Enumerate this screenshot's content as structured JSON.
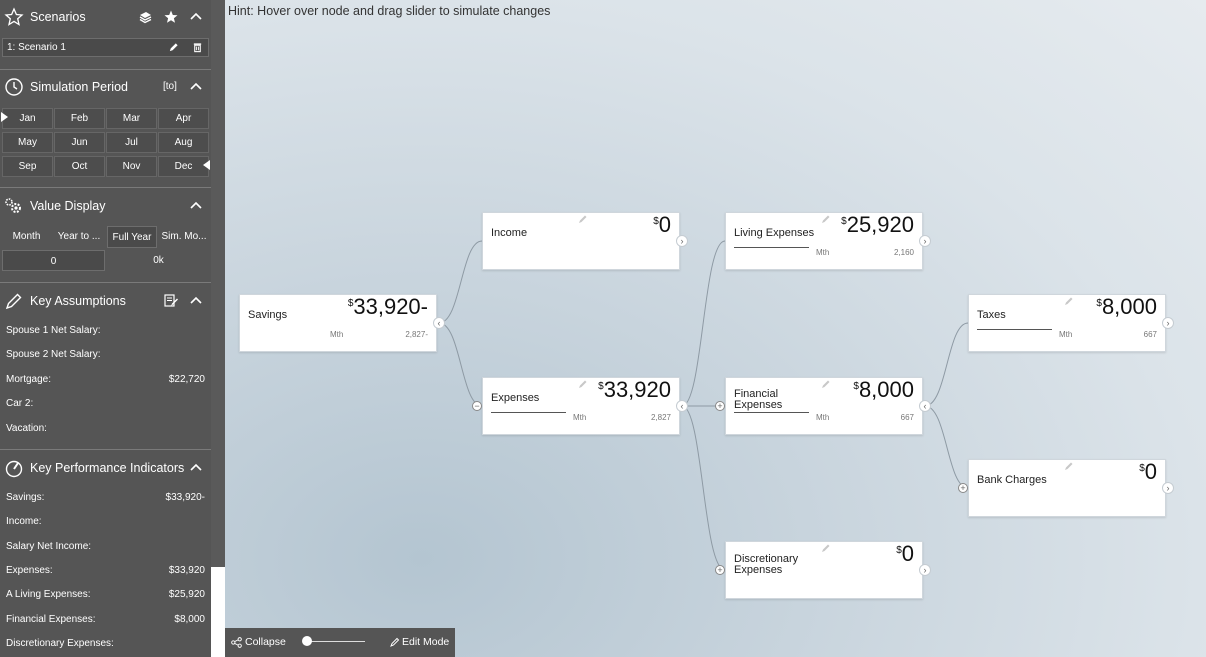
{
  "sidebar": {
    "scenarios": {
      "title": "Scenarios",
      "current": "1: Scenario 1"
    },
    "simulation_period": {
      "title": "Simulation Period",
      "toggle_label": "[to]",
      "months": [
        "Jan",
        "Feb",
        "Mar",
        "Apr",
        "May",
        "Jun",
        "Jul",
        "Aug",
        "Sep",
        "Oct",
        "Nov",
        "Dec"
      ]
    },
    "value_display": {
      "title": "Value Display",
      "tabs": [
        "Month",
        "Year to ...",
        "Full Year",
        "Sim. Mo..."
      ],
      "selected_tab": "Full Year",
      "decimals": "0",
      "scale": "0k"
    },
    "key_assumptions": {
      "title": "Key Assumptions",
      "items": [
        {
          "label": "Spouse 1 Net Salary:",
          "value": ""
        },
        {
          "label": "Spouse 2 Net Salary:",
          "value": ""
        },
        {
          "label": "Mortgage:",
          "value": "$22,720"
        },
        {
          "label": "Car 2:",
          "value": ""
        },
        {
          "label": "Vacation:",
          "value": ""
        }
      ]
    },
    "kpi": {
      "title": "Key Performance Indicators",
      "items": [
        {
          "label": "Savings:",
          "value": "$33,920-"
        },
        {
          "label": "Income:",
          "value": ""
        },
        {
          "label": "Salary Net Income:",
          "value": ""
        },
        {
          "label": "Expenses:",
          "value": "$33,920"
        },
        {
          "label": "A Living Expenses:",
          "value": "$25,920"
        },
        {
          "label": "Financial Expenses:",
          "value": "$8,000"
        },
        {
          "label": "Discretionary Expenses:",
          "value": ""
        }
      ]
    }
  },
  "canvas": {
    "hint": "Hint: Hover over node and drag slider to simulate changes",
    "nodes": {
      "savings": {
        "name": "Savings",
        "currency": "$",
        "value": "33,920-",
        "mth": "Mth",
        "sub": "2,827-"
      },
      "income": {
        "name": "Income",
        "currency": "$",
        "value": "0"
      },
      "expenses": {
        "name": "Expenses",
        "currency": "$",
        "value": "33,920",
        "mth": "Mth",
        "sub": "2,827"
      },
      "living": {
        "name": "Living Expenses",
        "currency": "$",
        "value": "25,920",
        "mth": "Mth",
        "sub": "2,160"
      },
      "financial": {
        "name1": "Financial",
        "name2": "Expenses",
        "currency": "$",
        "value": "8,000",
        "mth": "Mth",
        "sub": "667"
      },
      "discretionary": {
        "name1": "Discretionary",
        "name2": "Expenses",
        "currency": "$",
        "value": "0"
      },
      "taxes": {
        "name": "Taxes",
        "currency": "$",
        "value": "8,000",
        "mth": "Mth",
        "sub": "667"
      },
      "bank": {
        "name": "Bank Charges",
        "currency": "$",
        "value": "0"
      }
    }
  },
  "bottombar": {
    "collapse_label": "Collapse",
    "edit_label": "Edit Mode"
  },
  "colors": {
    "sidebar_bg": "#555555",
    "canvas_bg": "#d3dde4",
    "node_bg": "#ffffff"
  }
}
